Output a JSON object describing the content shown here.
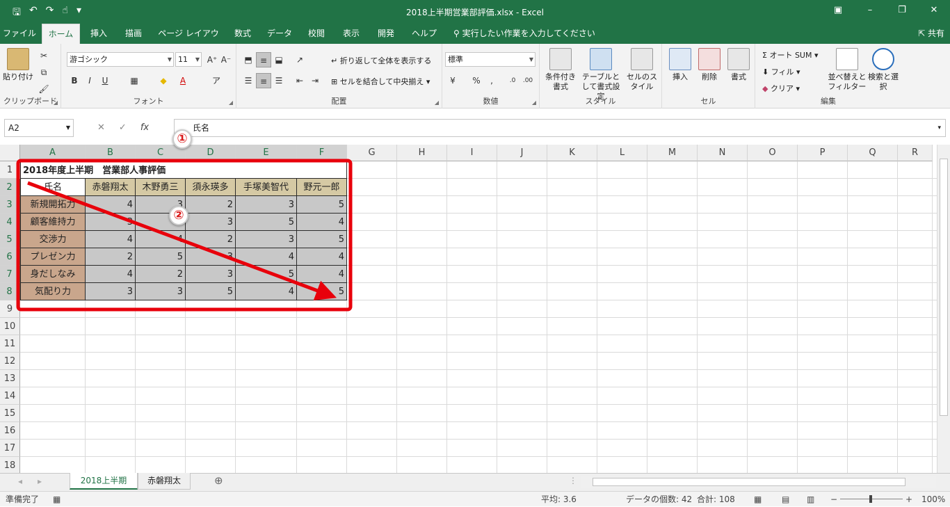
{
  "window": {
    "title": "2018上半期営業部評価.xlsx  -  Excel"
  },
  "tabs": [
    "ファイル",
    "ホーム",
    "挿入",
    "描画",
    "ページ レイアウト",
    "数式",
    "データ",
    "校閲",
    "表示",
    "開発",
    "ヘルプ"
  ],
  "tell_me": "実行したい作業を入力してください",
  "share": "共有",
  "ribbon": {
    "clipboard": {
      "label": "クリップボード",
      "paste": "貼り付け"
    },
    "font": {
      "label": "フォント",
      "name": "游ゴシック",
      "size": "11"
    },
    "alignment": {
      "label": "配置",
      "wrap": "折り返して全体を表示する",
      "merge": "セルを結合して中央揃え"
    },
    "number": {
      "label": "数値",
      "format": "標準"
    },
    "styles": {
      "label": "スタイル",
      "conditional": "条件付き書式",
      "table": "テーブルとして書式設定",
      "cell": "セルのスタイル"
    },
    "cells": {
      "label": "セル",
      "insert": "挿入",
      "delete": "削除",
      "format": "書式"
    },
    "editing": {
      "label": "編集",
      "autosum": "オート SUM",
      "fill": "フィル",
      "clear": "クリア",
      "sort": "並べ替えとフィルター",
      "find": "検索と選択"
    }
  },
  "formula": {
    "namebox": "A2",
    "content": "氏名"
  },
  "columns": [
    "A",
    "B",
    "C",
    "D",
    "E",
    "F",
    "G",
    "H",
    "I",
    "J",
    "K",
    "L",
    "M",
    "N",
    "O",
    "P",
    "Q",
    "R"
  ],
  "rows": [
    "1",
    "2",
    "3",
    "4",
    "5",
    "6",
    "7",
    "8",
    "9",
    "10",
    "11",
    "12",
    "13",
    "14",
    "15",
    "16",
    "17",
    "18"
  ],
  "sheet": {
    "title": "2018年度上半期　営業部人事評価",
    "header": [
      "氏名",
      "赤磐翔太",
      "木野勇三",
      "須永瑛多",
      "手塚美智代",
      "野元一郎"
    ],
    "data": [
      [
        "新規開拓力",
        "4",
        "3",
        "2",
        "3",
        "5"
      ],
      [
        "顧客維持力",
        "3",
        "4",
        "3",
        "5",
        "4"
      ],
      [
        "交渉力",
        "4",
        "4",
        "2",
        "3",
        "5"
      ],
      [
        "プレゼン力",
        "2",
        "5",
        "3",
        "4",
        "4"
      ],
      [
        "身だしなみ",
        "4",
        "2",
        "3",
        "5",
        "4"
      ],
      [
        "気配り力",
        "3",
        "3",
        "5",
        "4",
        "5"
      ]
    ]
  },
  "callouts": [
    "①",
    "②"
  ],
  "sheet_tabs": [
    "2018上半期",
    "赤磐翔太"
  ],
  "status": {
    "ready": "準備完了",
    "average": "平均: 3.6",
    "count": "データの個数: 42",
    "sum": "合計: 108",
    "zoom": "100%"
  },
  "colors": {
    "excel_green": "#217346",
    "annotation_red": "#e8000b",
    "label_fill": "#c9a68c",
    "header_fill": "#d5c9a4",
    "value_fill": "#c8c8c8"
  }
}
